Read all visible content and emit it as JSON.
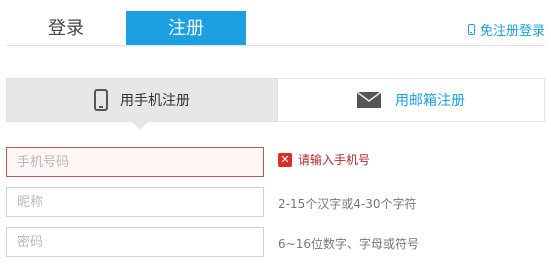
{
  "tabs": {
    "login": "登录",
    "register": "注册"
  },
  "phone_register_link": "免注册登录",
  "method": {
    "phone": "用手机注册",
    "email": "用邮箱注册"
  },
  "fields": {
    "phone_placeholder": "手机号码",
    "nick_placeholder": "昵称",
    "password_placeholder": "密码"
  },
  "hints": {
    "phone_error": "请输入手机号",
    "nick": "2-15个汉字或4-30个字符",
    "password": "6~16位数字、字母或符号"
  },
  "colors": {
    "accent": "#1ba0e1",
    "error": "#d9302c"
  },
  "icons": {
    "phone": "mobile-phone-icon",
    "email": "envelope-icon",
    "error": "error-x-icon"
  }
}
